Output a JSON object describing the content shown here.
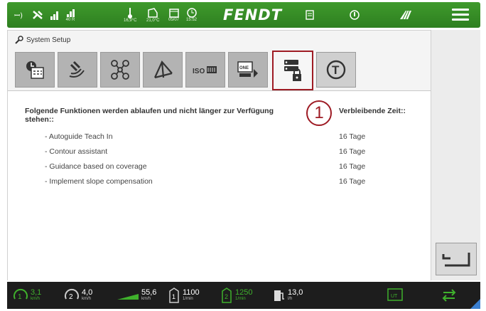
{
  "status_bar": {
    "reception_number": "40 R",
    "outside_temp": "16,9°C",
    "cabin_temp": "21,0°C",
    "date": "05/07",
    "time": "15:52",
    "brand": "FENDT"
  },
  "system_setup": {
    "title": "System Setup",
    "tabs": [
      {
        "name": "tab-clock-calendar",
        "icon": "clock-calendar-icon"
      },
      {
        "name": "tab-satellite",
        "icon": "satellite-icon"
      },
      {
        "name": "tab-network",
        "icon": "network-icon"
      },
      {
        "name": "tab-implement",
        "icon": "implement-icon"
      },
      {
        "name": "tab-isobus",
        "icon": "isobus-icon",
        "label": "ISO"
      },
      {
        "name": "tab-fendt-one",
        "icon": "fendt-one-icon",
        "label": "ONE"
      },
      {
        "name": "tab-licenses",
        "icon": "license-lock-icon",
        "active": true
      },
      {
        "name": "tab-trial",
        "icon": "trial-t-icon"
      }
    ]
  },
  "content": {
    "intro": "Folgende Funktionen werden ablaufen und nicht länger zur Verfügung stehen::",
    "remaining_header": "Verbleibende Zeit::",
    "callout_number": "1",
    "features": [
      {
        "name": "- Autoguide Teach In",
        "remaining": "16 Tage"
      },
      {
        "name": "- Contour assistant",
        "remaining": "16 Tage"
      },
      {
        "name": "- Guidance based on coverage",
        "remaining": "16 Tage"
      },
      {
        "name": "- Implement slope compensation",
        "remaining": "16 Tage"
      }
    ]
  },
  "bottom_bar": {
    "speed1": {
      "value": "3,1",
      "unit": "km/h"
    },
    "speed2": {
      "value": "4,0",
      "unit": "km/h"
    },
    "speed3": {
      "value": "55,6",
      "unit": "km/h"
    },
    "pto1": {
      "value": "1100",
      "unit": "1/min"
    },
    "pto2": {
      "value": "1250",
      "unit": "1/min"
    },
    "fuel": {
      "value": "13,0",
      "unit": "l/h"
    },
    "ut_label": "UT"
  },
  "colors": {
    "accent_red": "#9e1b24",
    "fendt_green": "#3f9a2c",
    "bar_dark": "#1d1d1d"
  }
}
